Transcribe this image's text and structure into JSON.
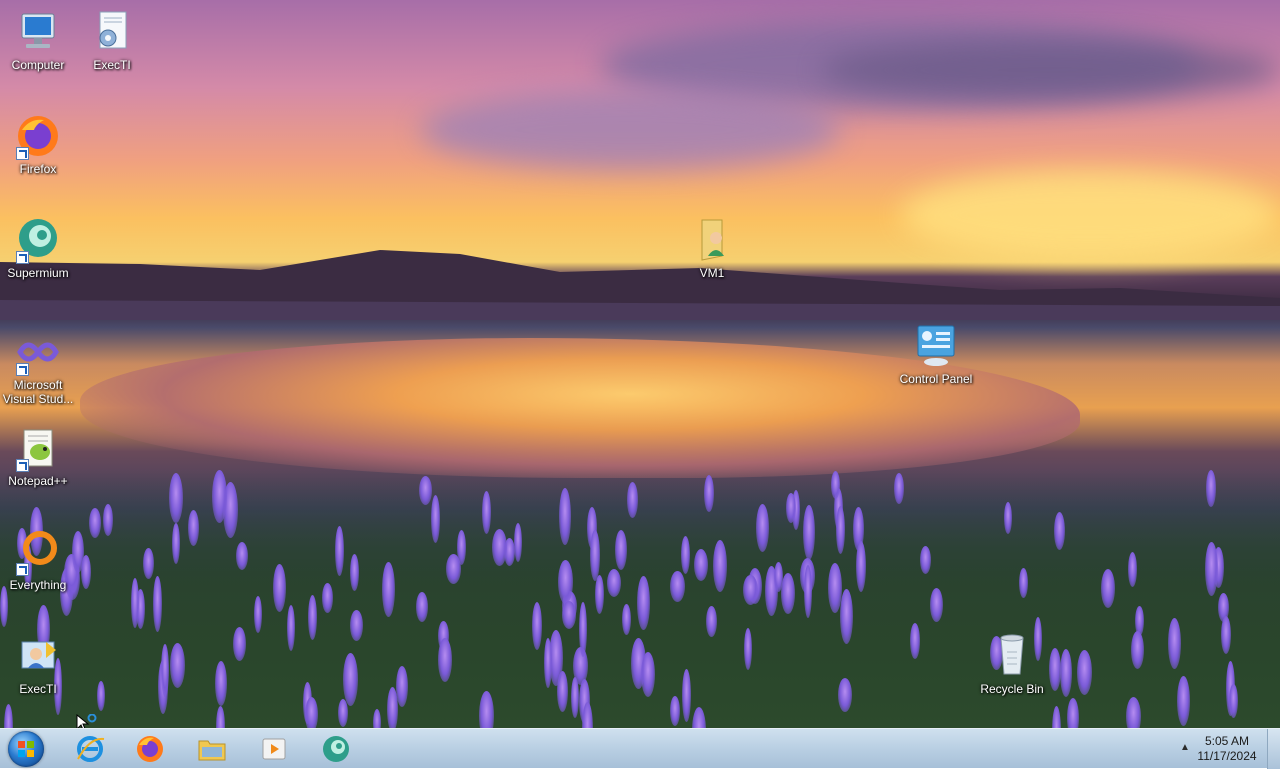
{
  "desktop": {
    "icons": [
      {
        "label": "Computer",
        "icon": "computer-icon"
      },
      {
        "label": "ExecTI",
        "icon": "settings-document-icon"
      },
      {
        "label": "Firefox",
        "icon": "firefox-icon"
      },
      {
        "label": "Supermium",
        "icon": "supermium-icon"
      },
      {
        "label": "VM1",
        "icon": "user-folder-icon"
      },
      {
        "label": "Microsoft Visual Stud...",
        "icon": "visual-studio-icon"
      },
      {
        "label": "Control Panel",
        "icon": "control-panel-icon"
      },
      {
        "label": "Notepad++",
        "icon": "notepad-plus-plus-icon"
      },
      {
        "label": "Everything",
        "icon": "everything-search-icon"
      },
      {
        "label": "ExecTI",
        "icon": "execti-admin-icon"
      },
      {
        "label": "Recycle Bin",
        "icon": "recycle-bin-icon"
      }
    ]
  },
  "taskbar": {
    "start_icon": "windows-start-orb-icon",
    "pinned": [
      {
        "name": "Internet Explorer",
        "icon": "internet-explorer-icon"
      },
      {
        "name": "Firefox",
        "icon": "firefox-icon"
      },
      {
        "name": "File Explorer",
        "icon": "file-explorer-icon"
      },
      {
        "name": "Media Player",
        "icon": "media-player-icon"
      },
      {
        "name": "Supermium",
        "icon": "supermium-icon"
      }
    ],
    "clock": {
      "time": "5:05 AM",
      "date": "11/17/2024"
    },
    "tray_arrow": "▲"
  },
  "colors": {
    "taskbar_top": "#cfe0ee",
    "taskbar_bottom": "#a7c0d8",
    "label_text": "#ffffff"
  }
}
